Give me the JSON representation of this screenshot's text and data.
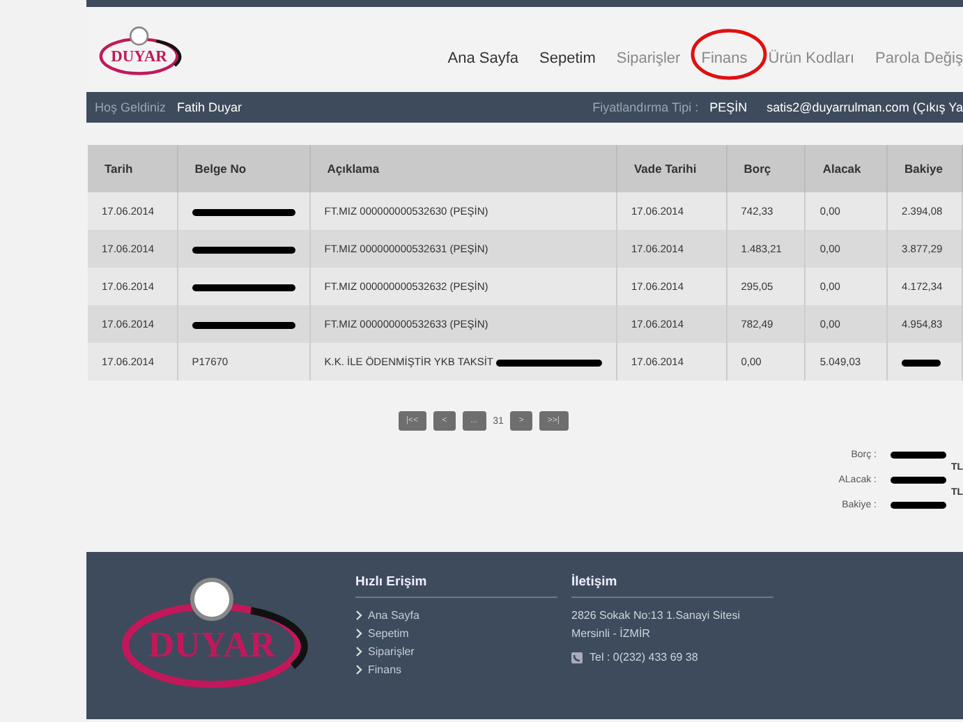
{
  "header": {
    "logo_text": "DUYAR",
    "nav": [
      {
        "label": "Ana Sayfa",
        "dim": false,
        "circled": false
      },
      {
        "label": "Sepetim",
        "dim": false,
        "circled": false
      },
      {
        "label": "Siparişler",
        "dim": true,
        "circled": false
      },
      {
        "label": "Finans",
        "dim": true,
        "circled": true
      },
      {
        "label": "Ürün Kodları",
        "dim": true,
        "circled": false
      },
      {
        "label": "Parola Değiş",
        "dim": true,
        "circled": false
      }
    ]
  },
  "user_bar": {
    "welcome_label": "Hoş Geldiniz",
    "user_name": "Fatih Duyar",
    "pricing_label": "Fiyatlandırma Tipi :",
    "pricing_value": "PEŞİN",
    "email": "satis2@duyarrulman.com (Çıkış Ya"
  },
  "table": {
    "columns": [
      "Tarih",
      "Belge No",
      "Açıklama",
      "Vade Tarihi",
      "Borç",
      "Alacak",
      "Bakiye"
    ],
    "rows": [
      {
        "tarih": "17.06.2014",
        "belge_no_redacted": true,
        "aciklama": "FT.MIZ 000000000532630 (PEŞİN)",
        "vade": "17.06.2014",
        "borc": "742,33",
        "alacak": "0,00",
        "bakiye": "2.394,08"
      },
      {
        "tarih": "17.06.2014",
        "belge_no_redacted": true,
        "aciklama": "FT.MIZ 000000000532631 (PEŞİN)",
        "vade": "17.06.2014",
        "borc": "1.483,21",
        "alacak": "0,00",
        "bakiye": "3.877,29"
      },
      {
        "tarih": "17.06.2014",
        "belge_no_redacted": true,
        "aciklama": "FT.MIZ 000000000532632 (PEŞİN)",
        "vade": "17.06.2014",
        "borc": "295,05",
        "alacak": "0,00",
        "bakiye": "4.172,34"
      },
      {
        "tarih": "17.06.2014",
        "belge_no_redacted": true,
        "aciklama": "FT.MIZ 000000000532633 (PEŞİN)",
        "vade": "17.06.2014",
        "borc": "782,49",
        "alacak": "0,00",
        "bakiye": "4.954,83"
      },
      {
        "tarih": "17.06.2014",
        "belge_no": "P17670",
        "aciklama": "K.K. İLE ÖDENMİŞTİR YKB TAKSİT",
        "aciklama_redacted": true,
        "vade": "17.06.2014",
        "borc": "0,00",
        "alacak": "5.049,03",
        "bakiye_redacted": true
      }
    ]
  },
  "pagination": {
    "first": "|<<",
    "prev": "<",
    "ellipsis": "...",
    "page": "31",
    "next": ">",
    "last": ">>|"
  },
  "totals": [
    {
      "label": "Borç :",
      "unit": "TL"
    },
    {
      "label": "ALacak :",
      "unit": "TL"
    },
    {
      "label": "Bakiye :"
    }
  ],
  "footer": {
    "logo_text": "DUYAR",
    "quick_links": {
      "title": "Hızlı Erişim",
      "items": [
        "Ana Sayfa",
        "Sepetim",
        "Siparişler",
        "Finans"
      ]
    },
    "contact": {
      "title": "İletişim",
      "address_lines": [
        "2826 Sokak No:13 1.Sanayi Sitesi",
        "Mersinli - İZMİR"
      ],
      "phone": "Tel : 0(232) 433 69 38"
    }
  }
}
